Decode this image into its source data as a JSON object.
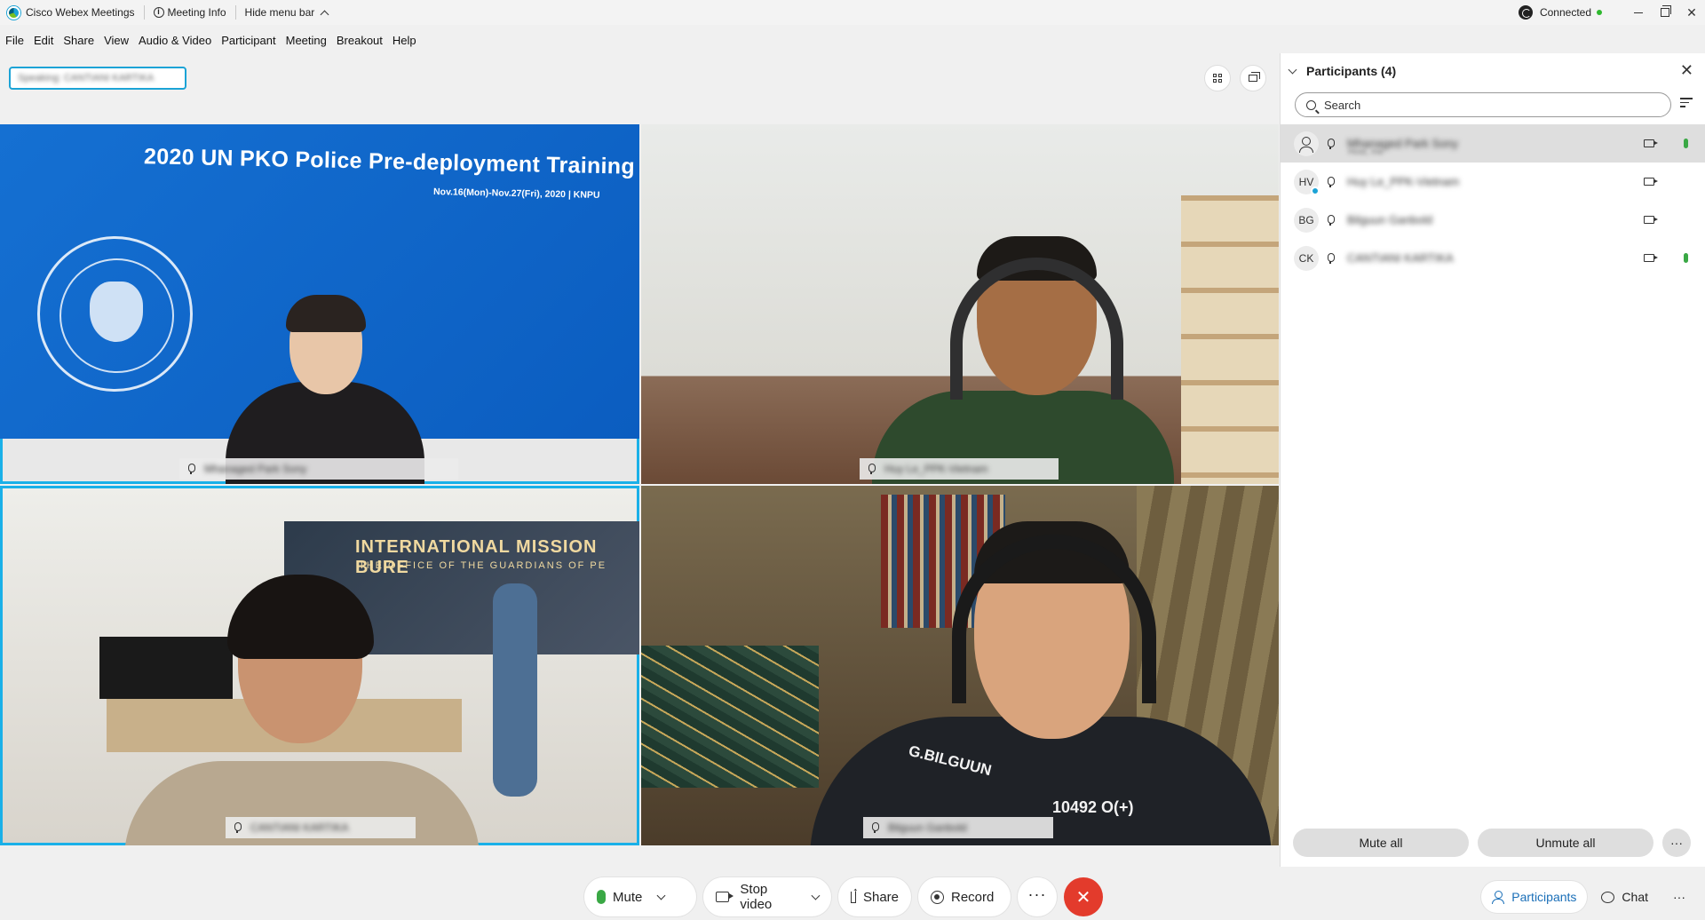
{
  "titlebar": {
    "app_name": "Cisco Webex Meetings",
    "meeting_info": "Meeting Info",
    "hide_menu": "Hide menu bar",
    "connection_status": "Connected"
  },
  "menu": [
    "File",
    "Edit",
    "Share",
    "View",
    "Audio & Video",
    "Participant",
    "Meeting",
    "Breakout",
    "Help"
  ],
  "speaking_label": "Speaking: CANTIANI KARTIKA",
  "tiles": [
    {
      "name": "Mhanaged Park Sony",
      "banner_title": "2020 UN PKO Police Pre-deployment Training",
      "banner_dates": "Nov.16(Mon)-Nov.27(Fri), 2020 | KNPU",
      "active": true
    },
    {
      "name": "Huy Le_PPK-Vietnam",
      "active": false
    },
    {
      "name": "CANTIANI KARTIKA",
      "wall_text": "INTERNATIONAL MISSION BURE",
      "wall_subtext": "THE OFFICE OF THE GUARDIANS OF PE",
      "active": true
    },
    {
      "name": "Bilguun Ganbold",
      "patch_text": "G.BILGUUN",
      "badge_text": "10492 O(+)",
      "active": false
    }
  ],
  "toolbar": {
    "mute": "Mute",
    "stop_video": "Stop video",
    "share": "Share",
    "record": "Record",
    "more": "···",
    "end": "✕"
  },
  "panel": {
    "title": "Participants (4)",
    "search_placeholder": "Search",
    "participants": [
      {
        "initials": "",
        "name": "Mhanaged Park Sony",
        "sub": "Host, me",
        "selected": true,
        "mic_active": true
      },
      {
        "initials": "HV",
        "name": "Huy Le_PPK-Vietnam",
        "sub": "",
        "selected": false,
        "mic_active": false
      },
      {
        "initials": "BG",
        "name": "Bilguun Ganbold",
        "sub": "",
        "selected": false,
        "mic_active": false
      },
      {
        "initials": "CK",
        "name": "CANTIANI KARTIKA",
        "sub": "",
        "selected": false,
        "mic_active": true
      }
    ],
    "mute_all": "Mute all",
    "unmute_all": "Unmute all",
    "more": "···"
  },
  "bottom_tabs": {
    "participants": "Participants",
    "chat": "Chat",
    "more": "···"
  },
  "colors": {
    "active_border": "#1ab0e8",
    "end_call": "#e33b2c",
    "mic_green": "#3aa845",
    "tab_active": "#1a6fb8"
  }
}
